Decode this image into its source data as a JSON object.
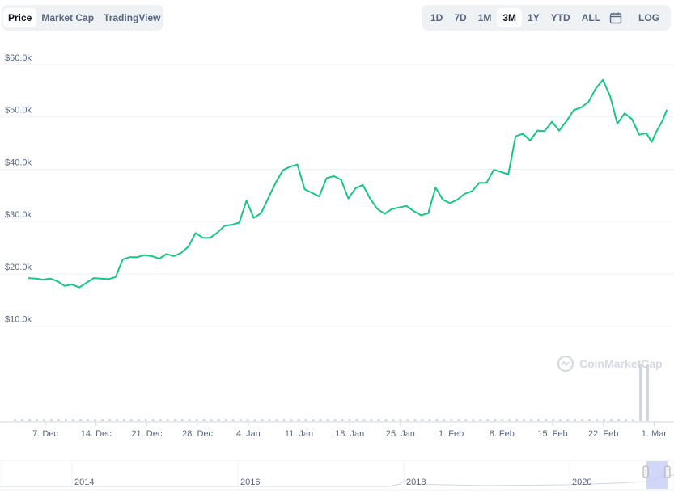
{
  "tabs_left": [
    {
      "label": "Price",
      "active": true
    },
    {
      "label": "Market Cap",
      "active": false
    },
    {
      "label": "TradingView",
      "active": false
    }
  ],
  "range_buttons": [
    {
      "label": "1D",
      "active": false
    },
    {
      "label": "7D",
      "active": false
    },
    {
      "label": "1M",
      "active": false
    },
    {
      "label": "3M",
      "active": true
    },
    {
      "label": "1Y",
      "active": false
    },
    {
      "label": "YTD",
      "active": false
    },
    {
      "label": "ALL",
      "active": false
    }
  ],
  "calendar_icon": "calendar-icon",
  "log_label": "LOG",
  "watermark": "CoinMarketCap",
  "colors": {
    "line": "#16c784",
    "grid": "#eff2f5",
    "axis_text": "#58667e",
    "volume_bar": "#cfd6e4",
    "navigator_highlight": "#c5cdf8"
  },
  "chart_data": {
    "type": "line",
    "y_ticks": [
      "$10.0k",
      "$20.0k",
      "$30.0k",
      "$40.0k",
      "$50.0k",
      "$60.0k"
    ],
    "y_tick_values": [
      10000,
      20000,
      30000,
      40000,
      50000,
      60000
    ],
    "ylim": [
      5000,
      60000
    ],
    "x_ticks": [
      "7. Dec",
      "14. Dec",
      "21. Dec",
      "28. Dec",
      "4. Jan",
      "11. Jan",
      "18. Jan",
      "25. Jan",
      "1. Feb",
      "8. Feb",
      "15. Feb",
      "22. Feb",
      "1. Mar"
    ],
    "x_range_days": [
      -3,
      85
    ],
    "values": [
      [
        0,
        19200
      ],
      [
        1,
        19100
      ],
      [
        2,
        18900
      ],
      [
        3,
        19100
      ],
      [
        4,
        18600
      ],
      [
        5,
        17700
      ],
      [
        6,
        18000
      ],
      [
        7,
        17400
      ],
      [
        8,
        18300
      ],
      [
        9,
        19200
      ],
      [
        10,
        19100
      ],
      [
        11,
        19000
      ],
      [
        12,
        19400
      ],
      [
        13,
        22800
      ],
      [
        14,
        23200
      ],
      [
        15,
        23200
      ],
      [
        16,
        23600
      ],
      [
        17,
        23400
      ],
      [
        18,
        22900
      ],
      [
        19,
        23800
      ],
      [
        20,
        23400
      ],
      [
        21,
        24000
      ],
      [
        22,
        25200
      ],
      [
        23,
        27800
      ],
      [
        24,
        26900
      ],
      [
        25,
        26900
      ],
      [
        26,
        27900
      ],
      [
        27,
        29200
      ],
      [
        28,
        29400
      ],
      [
        29,
        29800
      ],
      [
        30,
        34000
      ],
      [
        31,
        30700
      ],
      [
        32,
        31600
      ],
      [
        33,
        34500
      ],
      [
        34,
        37400
      ],
      [
        35,
        39800
      ],
      [
        36,
        40500
      ],
      [
        37,
        40900
      ],
      [
        38,
        36200
      ],
      [
        39,
        35500
      ],
      [
        40,
        34800
      ],
      [
        41,
        38300
      ],
      [
        42,
        38700
      ],
      [
        43,
        38000
      ],
      [
        44,
        34400
      ],
      [
        45,
        36400
      ],
      [
        46,
        37000
      ],
      [
        47,
        34400
      ],
      [
        48,
        32400
      ],
      [
        49,
        31500
      ],
      [
        50,
        32400
      ],
      [
        51,
        32700
      ],
      [
        52,
        33000
      ],
      [
        53,
        32000
      ],
      [
        54,
        31200
      ],
      [
        55,
        31600
      ],
      [
        56,
        36500
      ],
      [
        57,
        34200
      ],
      [
        58,
        33500
      ],
      [
        59,
        34200
      ],
      [
        60,
        35300
      ],
      [
        61,
        35800
      ],
      [
        62,
        37400
      ],
      [
        63,
        37400
      ],
      [
        64,
        39900
      ],
      [
        65,
        39500
      ],
      [
        66,
        39000
      ],
      [
        67,
        46300
      ],
      [
        68,
        46800
      ],
      [
        69,
        45500
      ],
      [
        70,
        47400
      ],
      [
        71,
        47300
      ],
      [
        72,
        49100
      ],
      [
        73,
        47400
      ],
      [
        74,
        49200
      ],
      [
        75,
        51300
      ],
      [
        76,
        51800
      ],
      [
        77,
        52800
      ],
      [
        78,
        55400
      ],
      [
        79,
        57100
      ],
      [
        80,
        54000
      ],
      [
        81,
        48700
      ],
      [
        82,
        50700
      ],
      [
        83,
        49600
      ],
      [
        84,
        46600
      ],
      [
        85,
        46900
      ]
    ],
    "tail_values": [
      [
        85.7,
        45200
      ],
      [
        86.4,
        47300
      ],
      [
        87.2,
        49300
      ],
      [
        87.8,
        51400
      ]
    ],
    "navigator_labels": [
      "2014",
      "2016",
      "2018",
      "2020"
    ]
  }
}
